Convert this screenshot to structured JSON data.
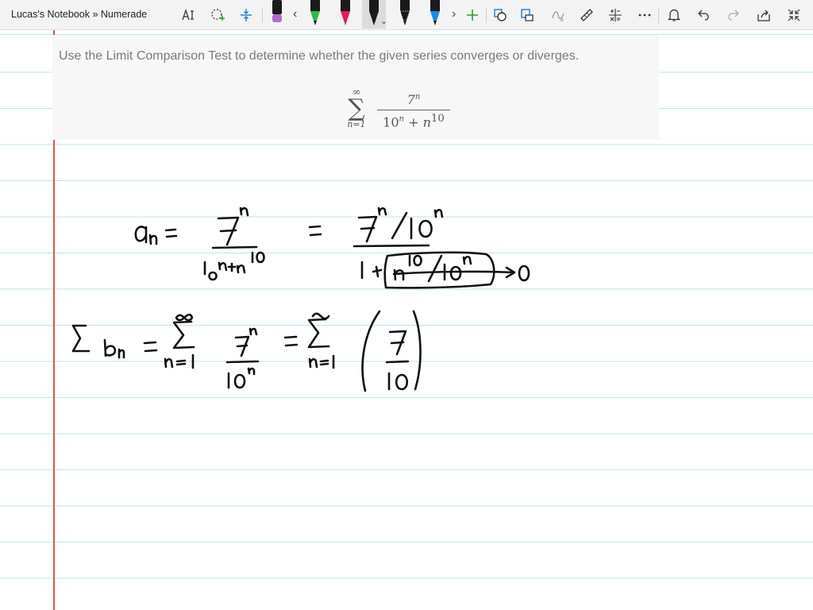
{
  "window": {
    "title": "Lucas's Notebook » Numerade"
  },
  "toolbar": {
    "tools": [
      {
        "name": "text-select-icon"
      },
      {
        "name": "lasso-select-icon"
      },
      {
        "name": "add-space-icon"
      },
      {
        "name": "pen-black-icon"
      },
      {
        "name": "pen-green-icon"
      },
      {
        "name": "pen-red-icon"
      },
      {
        "name": "pen-black-active-icon"
      },
      {
        "name": "pen-dark-icon"
      },
      {
        "name": "pen-blue-icon"
      },
      {
        "name": "add-pen-icon"
      },
      {
        "name": "ink-to-shape-icon"
      },
      {
        "name": "ink-to-text-icon"
      },
      {
        "name": "ink-to-math-icon"
      },
      {
        "name": "ruler-icon"
      },
      {
        "name": "math-icon"
      },
      {
        "name": "more-icon"
      },
      {
        "name": "notifications-icon"
      },
      {
        "name": "undo-icon"
      },
      {
        "name": "redo-icon"
      },
      {
        "name": "share-icon"
      },
      {
        "name": "fullscreen-icon"
      }
    ],
    "pen_colors": {
      "black": "#1a1a1a",
      "green": "#2fb84a",
      "red": "#e31b5c",
      "blue": "#1e88e5",
      "highlighter": "#b06ccf",
      "accent_green": "#2e9d2e",
      "accent_blue": "#1e7bd6"
    }
  },
  "problem": {
    "instruction": "Use the Limit Comparison Test to determine whether the given series converges or diverges.",
    "sum_upper": "∞",
    "sum_symbol": "∑",
    "sum_lower": "n=1",
    "numerator": "7",
    "numerator_exp": "n",
    "denominator_base1": "10",
    "denominator_exp1": "n",
    "denominator_plus": "+",
    "denominator_var": "n",
    "denominator_exp2": "10"
  },
  "colors": {
    "margin_line": "#e05353",
    "rule_line": "#bfe2f2",
    "ink": "#111111"
  }
}
